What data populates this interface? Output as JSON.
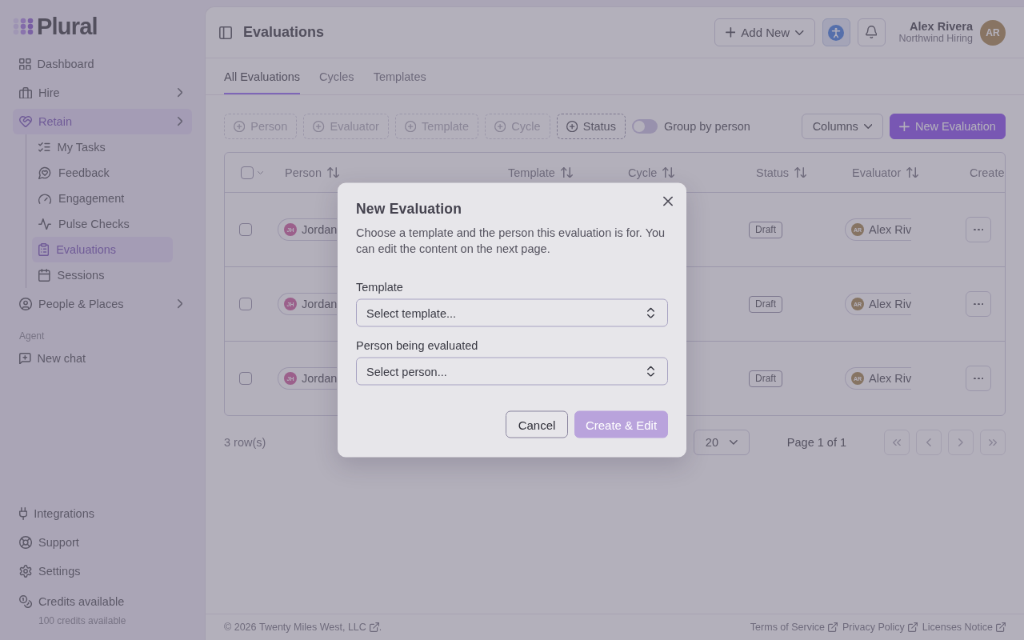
{
  "sidebar": {
    "logo": "Plural",
    "nav": [
      {
        "label": "Dashboard",
        "selected": false,
        "submenu": false
      },
      {
        "label": "Hire",
        "selected": false,
        "submenu": true
      },
      {
        "label": "Retain",
        "selected": true,
        "submenu": true,
        "children": [
          {
            "label": "My Tasks",
            "selected": false
          },
          {
            "label": "Feedback",
            "selected": false
          },
          {
            "label": "Engagement",
            "selected": false
          },
          {
            "label": "Pulse Checks",
            "selected": false
          },
          {
            "label": "Evaluations",
            "selected": true
          },
          {
            "label": "Sessions",
            "selected": false
          }
        ]
      },
      {
        "label": "People & Places",
        "selected": false,
        "submenu": true
      }
    ],
    "agent": {
      "heading": "Agent",
      "items": [
        {
          "label": "New chat"
        }
      ]
    },
    "bottom": [
      {
        "label": "Integrations"
      },
      {
        "label": "Support"
      },
      {
        "label": "Settings"
      }
    ],
    "credits": {
      "label": "Credits available",
      "detail": "100 credits available"
    }
  },
  "header": {
    "title": "Evaluations",
    "add_button": "Add New",
    "user": {
      "name": "Alex Rivera",
      "org": "Northwind Hiring",
      "initials": "AR"
    }
  },
  "tabs": [
    {
      "label": "All Evaluations",
      "selected": true
    },
    {
      "label": "Cycles",
      "selected": false
    },
    {
      "label": "Templates",
      "selected": false
    }
  ],
  "filters": [
    {
      "label": "Person",
      "disabled": true
    },
    {
      "label": "Evaluator",
      "disabled": true
    },
    {
      "label": "Template",
      "disabled": true
    },
    {
      "label": "Cycle",
      "disabled": true
    },
    {
      "label": "Status",
      "disabled": false
    }
  ],
  "group_by": {
    "label": "Group by person",
    "on": false
  },
  "toolbar": {
    "columns": "Columns",
    "new_evaluation": "New Evaluation"
  },
  "table": {
    "select_all": {
      "checked": false
    },
    "columns": [
      {
        "label": "Person",
        "sortable": true
      },
      {
        "label": "Template",
        "sortable": true
      },
      {
        "label": "Cycle",
        "sortable": true
      },
      {
        "label": "Status",
        "sortable": true
      },
      {
        "label": "Evaluator",
        "sortable": true
      },
      {
        "label": "Create",
        "sortable": false
      }
    ],
    "rows": [
      {
        "selected": false,
        "person": {
          "initials": "JH",
          "name": "Jordan"
        },
        "status": "Draft",
        "evaluator": {
          "initials": "AR",
          "name": "Alex Riv"
        }
      },
      {
        "selected": false,
        "person": {
          "initials": "JH",
          "name": "Jordan"
        },
        "status": "Draft",
        "evaluator": {
          "initials": "AR",
          "name": "Alex Riv"
        }
      },
      {
        "selected": false,
        "person": {
          "initials": "JH",
          "name": "Jordan"
        },
        "status": "Draft",
        "evaluator": {
          "initials": "AR",
          "name": "Alex Riv"
        }
      }
    ]
  },
  "pagination": {
    "count": "3 row(s)",
    "rows_per_page": "20",
    "page": "Page 1 of 1",
    "buttons": [
      {
        "kind": "first",
        "disabled": true
      },
      {
        "kind": "prev",
        "disabled": true
      },
      {
        "kind": "next",
        "disabled": true
      },
      {
        "kind": "last",
        "disabled": true
      }
    ]
  },
  "footer": {
    "copyright": {
      "prefix": "© 2026",
      "link": "Twenty Miles West, LLC",
      "suffix": "."
    },
    "links": [
      "Terms of Service",
      "Privacy Policy",
      "Licenses Notice"
    ]
  },
  "dialog": {
    "title": "New Evaluation",
    "description": "Choose a template and the person this evaluation is for. You can edit the content on the next page.",
    "fields": [
      {
        "label": "Template",
        "placeholder": "Select template..."
      },
      {
        "label": "Person being evaluated",
        "placeholder": "Select person..."
      }
    ],
    "cancel": "Cancel",
    "submit": {
      "label": "Create & Edit",
      "disabled": true
    }
  }
}
